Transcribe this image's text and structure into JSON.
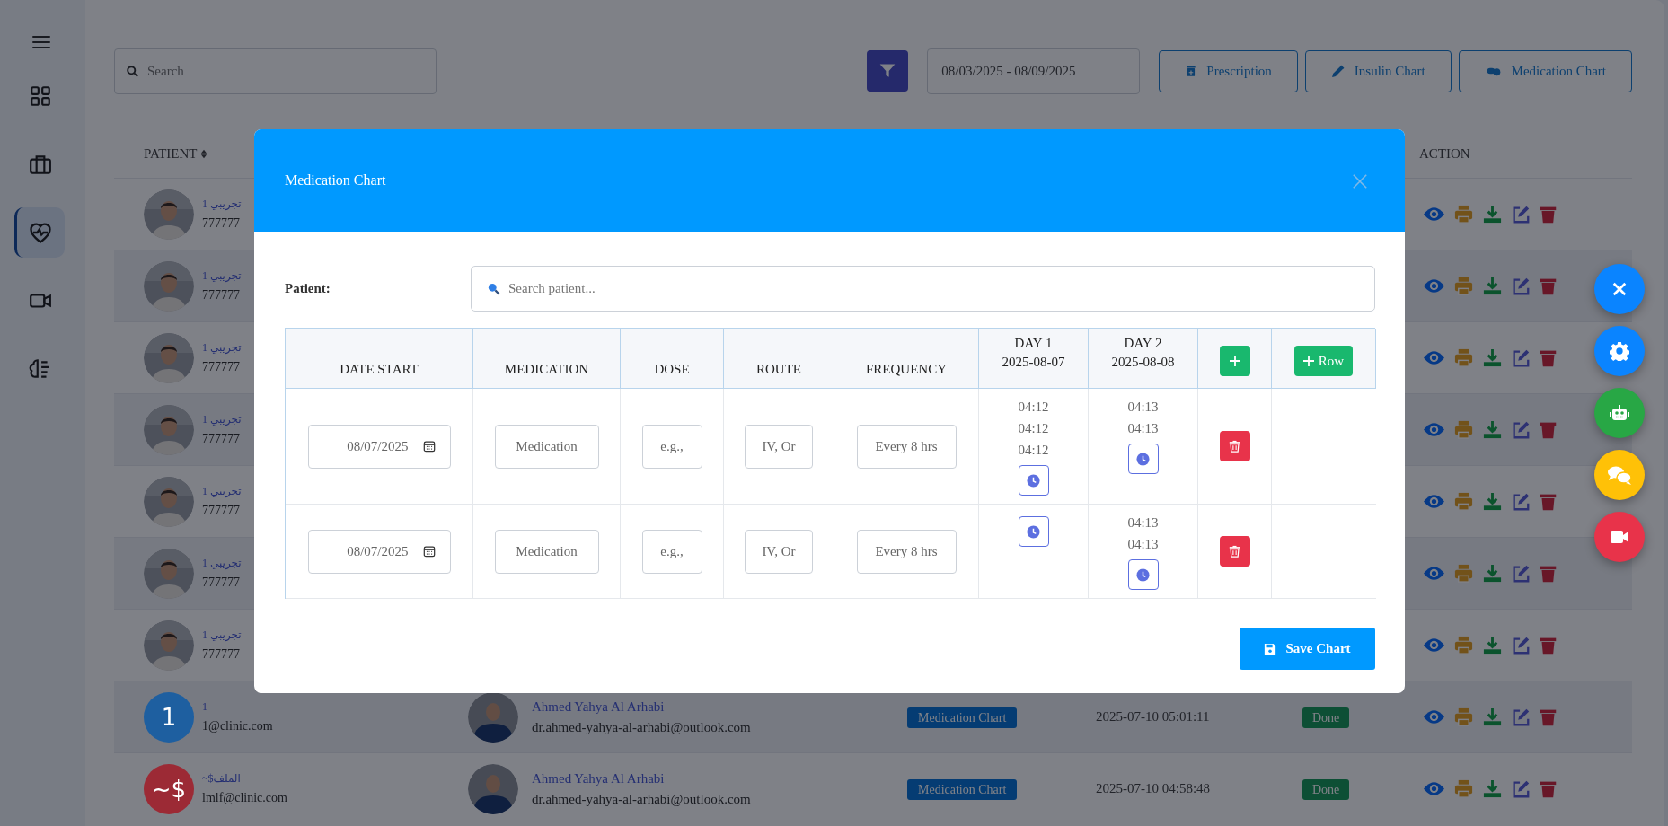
{
  "sidebar": {
    "items": [
      {
        "selected": false
      },
      {
        "selected": false
      },
      {
        "selected": true
      },
      {
        "selected": false
      },
      {
        "selected": false
      }
    ]
  },
  "toolbar": {
    "search": {
      "placeholder": "Search"
    },
    "date_range": "08/03/2025 - 08/09/2025",
    "buttons": [
      "Prescription",
      "Insulin Chart",
      "Medication Chart"
    ]
  },
  "table": {
    "columns": [
      "PATIENT",
      "ACTION"
    ],
    "rows": [
      {
        "patient": {
          "name": "تجريبي 1",
          "contact": "777777"
        }
      },
      {
        "patient": {
          "name": "تجريبي 1",
          "contact": "777777"
        }
      },
      {
        "patient": {
          "name": "تجريبي 1",
          "contact": "777777"
        }
      },
      {
        "patient": {
          "name": "تجريبي 1",
          "contact": "777777"
        }
      },
      {
        "patient": {
          "name": "تجريبي 1",
          "contact": "777777"
        }
      },
      {
        "patient": {
          "name": "تجريبي 1",
          "contact": "777777"
        }
      },
      {
        "patient": {
          "name": "تجريبي 1",
          "contact": "777777"
        }
      },
      {
        "patient": {
          "name": "1",
          "contact": "1@clinic.com",
          "avatar": {
            "kind": "letter",
            "text": "1",
            "color": "#1e5fa0"
          }
        },
        "doctor": {
          "name": "Ahmed Yahya Al Arhabi",
          "email": "dr.ahmed-yahya-al-arhabi@outlook.com"
        },
        "type": "Medication Chart",
        "date": "2025-07-10 05:01:11",
        "status": "Done"
      },
      {
        "patient": {
          "name": "~$الملف",
          "contact": "lmlf@clinic.com",
          "avatar": {
            "kind": "letter",
            "text": "~$",
            "color": "#9c2a35"
          }
        },
        "doctor": {
          "name": "Ahmed Yahya Al Arhabi",
          "email": "dr.ahmed-yahya-al-arhabi@outlook.com"
        },
        "type": "Medication Chart",
        "date": "2025-07-10 04:58:48",
        "status": "Done"
      }
    ]
  },
  "modal": {
    "title": "Medication Chart",
    "patient_label": "Patient:",
    "patient_search": {
      "placeholder": "Search patient..."
    },
    "columns": [
      "DATE START",
      "MEDICATION",
      "DOSE",
      "ROUTE",
      "FREQUENCY"
    ],
    "days": [
      {
        "label": "DAY 1",
        "date": "2025-08-07"
      },
      {
        "label": "DAY 2",
        "date": "2025-08-08"
      }
    ],
    "add_row_label": "Row",
    "rows": [
      {
        "date_start": "08/07/2025",
        "medication": {
          "placeholder": "Medication"
        },
        "dose": {
          "placeholder": "e.g.,"
        },
        "route": {
          "placeholder": "IV, Or"
        },
        "frequency": {
          "placeholder": "Every 8 hrs"
        },
        "day_1_times": [
          "04:12",
          "04:12",
          "04:12"
        ],
        "day_2_times": [
          "04:13",
          "04:13"
        ]
      },
      {
        "date_start": "08/07/2025",
        "medication": {
          "placeholder": "Medication"
        },
        "dose": {
          "placeholder": "e.g.,"
        },
        "route": {
          "placeholder": "IV, Or"
        },
        "frequency": {
          "placeholder": "Every 8 hrs"
        },
        "day_2_times": [
          "04:13",
          "04:13"
        ]
      }
    ],
    "save_label": "Save Chart"
  }
}
